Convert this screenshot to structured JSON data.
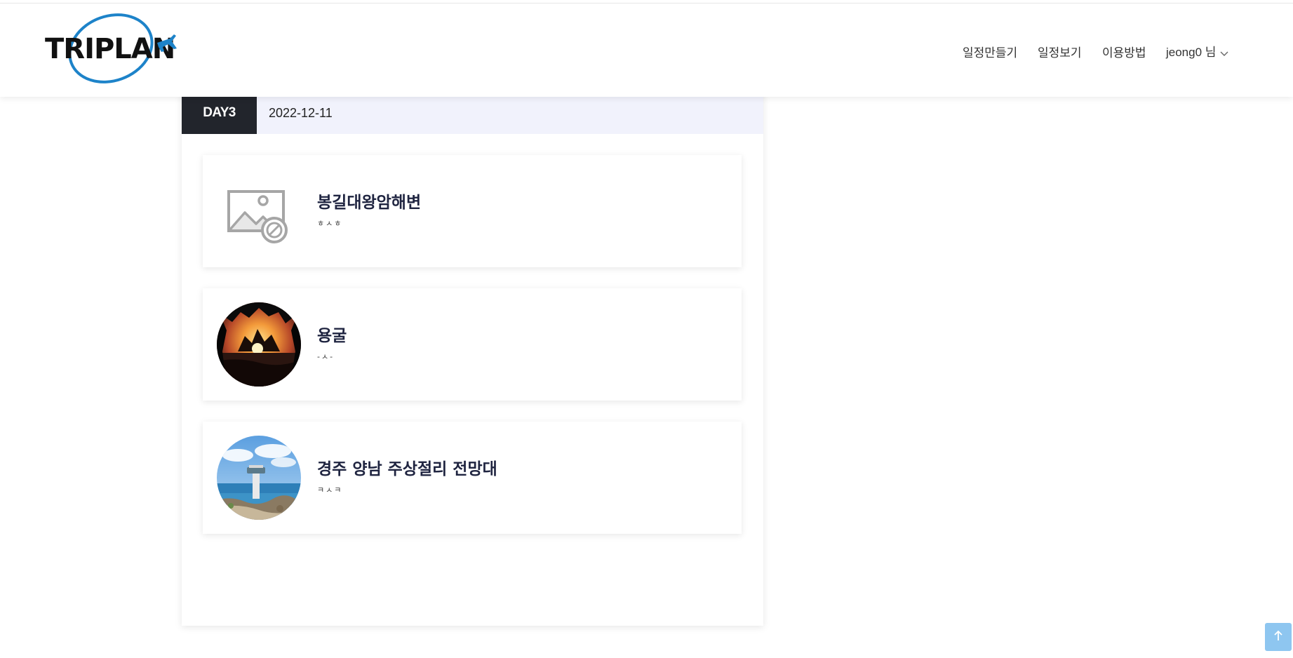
{
  "header": {
    "logo_text": "TRIPLAN",
    "nav": {
      "create_schedule": "일정만들기",
      "view_schedule": "일정보기",
      "how_to_use": "이용방법",
      "user_label": "jeong0 님"
    }
  },
  "day": {
    "badge": "DAY3",
    "date": "2022-12-11"
  },
  "places": [
    {
      "name": "봉길대왕암해변",
      "memo": "ㅎㅅㅎ",
      "thumbnail": "no-image-icon"
    },
    {
      "name": "용굴",
      "memo": "-ㅅ-",
      "thumbnail": "cave-sunset-photo"
    },
    {
      "name": "경주 양남 주상절리 전망대",
      "memo": "ㅋㅅㅋ",
      "thumbnail": "observatory-seaside-photo"
    }
  ],
  "colors": {
    "day_badge_bg": "#22252c",
    "day_bar_bg": "#f1f2fc",
    "place_name": "#1f2440",
    "logo_blue": "#1d83c9",
    "scroll_top_button": "#8ec6f0"
  },
  "icons": {
    "scroll_top": "arrow-up-icon",
    "user_menu": "chevron-down-icon"
  }
}
